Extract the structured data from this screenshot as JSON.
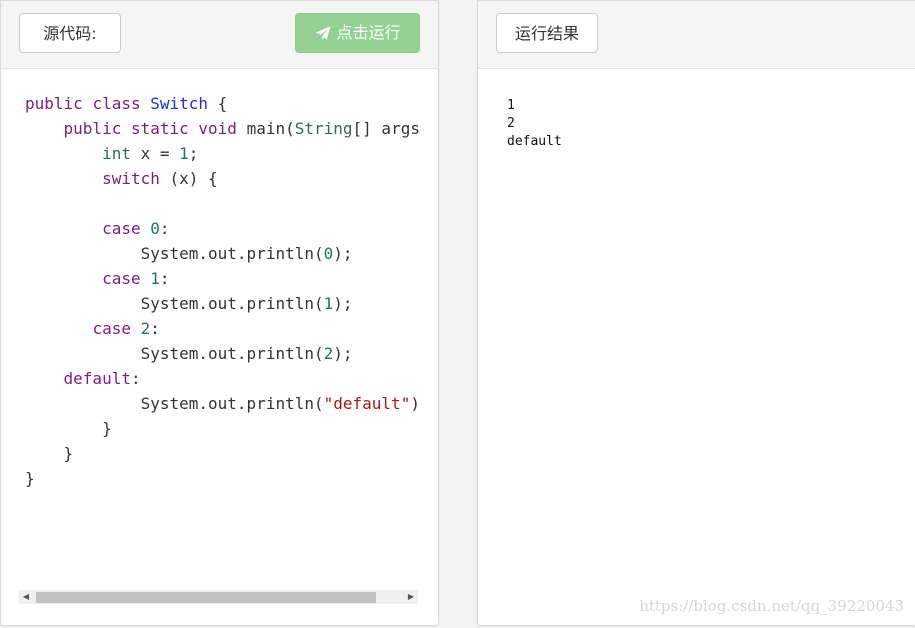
{
  "source_panel": {
    "label": "源代码:",
    "run_button": "点击运行",
    "code": {
      "line1": {
        "kw1": "public",
        "kw2": "class",
        "cls": "Switch",
        "rest": " {"
      },
      "line2": {
        "indent": "    ",
        "kw1": "public",
        "kw2": "static",
        "kw3": "void",
        "fn": " main(",
        "type": "String",
        "rest": "[] args"
      },
      "line3": {
        "indent": "        ",
        "type": "int",
        "mid": " x = ",
        "num": "1",
        "rest": ";"
      },
      "line4": {
        "indent": "        ",
        "kw": "switch",
        "rest": " (x) {"
      },
      "line6": {
        "indent": "        ",
        "kw": "case",
        "num": "0",
        "rest": ":"
      },
      "line7": {
        "indent": "            ",
        "pre": "System.out.println(",
        "num": "0",
        "rest": ");"
      },
      "line8": {
        "indent": "        ",
        "kw": "case",
        "num": "1",
        "rest": ":"
      },
      "line9": {
        "indent": "            ",
        "pre": "System.out.println(",
        "num": "1",
        "rest": ");"
      },
      "line10": {
        "indent": "       ",
        "kw": "case",
        "num": "2",
        "rest": ":"
      },
      "line11": {
        "indent": "            ",
        "pre": "System.out.println(",
        "num": "2",
        "rest": ");"
      },
      "line12": {
        "indent": "    ",
        "kw": "default",
        "rest": ":"
      },
      "line13": {
        "indent": "            ",
        "pre": "System.out.println(",
        "str": "\"default\"",
        "rest": ")"
      },
      "line14": "        }",
      "line15": "    }",
      "line16": "}"
    }
  },
  "result_panel": {
    "label": "运行结果",
    "output": "1\n2\ndefault"
  },
  "watermark": "https://blog.csdn.net/qq_39220043",
  "colors": {
    "run_button": "#93d293",
    "keyword": "#7a1f7f",
    "type": "#2f6e48",
    "class_name": "#1b2fe0",
    "number": "#1a7a5a",
    "string": "#a31a15"
  },
  "icons": {
    "run": "paper-plane-icon",
    "scroll_left": "arrow-left-icon",
    "scroll_right": "arrow-right-icon"
  }
}
